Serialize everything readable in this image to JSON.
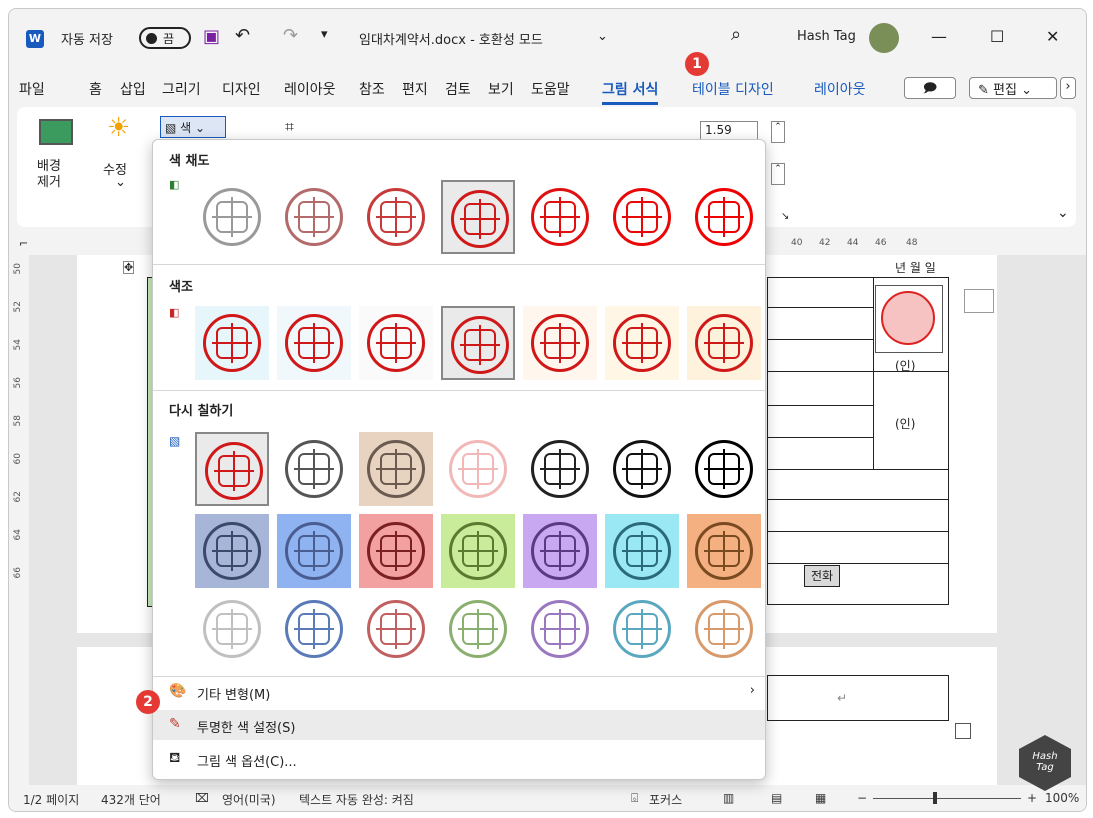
{
  "titlebar": {
    "autosave_label": "자동 저장",
    "autosave_state": "끔",
    "doc_title": "임대차계약서.docx - 호환성 모드",
    "doc_title_chevron": "⌄",
    "user_name": "Hash Tag",
    "undo_icon": "↶",
    "redo_icon": "↷",
    "customize_icon": "▾",
    "search_icon": "⌕",
    "minimize": "—",
    "maximize": "☐",
    "close": "✕"
  },
  "tabs": [
    "파일",
    "홈",
    "삽입",
    "그리기",
    "디자인",
    "레이아웃",
    "참조",
    "편지",
    "검토",
    "보기",
    "도움말",
    "그림 서식",
    "테이블 디자인",
    "레이아웃"
  ],
  "tab_active": "그림 서식",
  "tab_buttons": {
    "comment": "🗩",
    "edit": "편집",
    "edit_chevron": "⌄",
    "more": "›"
  },
  "ribbon": {
    "remove_bg_line1": "배경",
    "remove_bg_line2": "제거",
    "corrections": "수정",
    "corrections_chevron": "⌄",
    "color": "색",
    "color_chevron": "⌄",
    "height_value": "1.59 cm",
    "collapse": "⌄"
  },
  "ruler": {
    "ticks": [
      "40",
      "42",
      "44",
      "46",
      "48"
    ]
  },
  "vruler": {
    "ticks": [
      "50",
      "52",
      "54",
      "56",
      "58",
      "60",
      "62",
      "64",
      "66"
    ]
  },
  "document": {
    "date_text": "년  월  일",
    "seal1": "(인)",
    "seal2": "(인)",
    "phone": "전화",
    "return_mark": "↵"
  },
  "menu": {
    "section_saturation": "색 채도",
    "section_tone": "색조",
    "section_recolor": "다시 칠하기",
    "item_variations": "기타 변형(M)",
    "item_variations_arrow": "›",
    "item_transparent": "투명한 색 설정(S)",
    "item_options": "그림 색 옵션(C)..."
  },
  "callouts": {
    "one": "1",
    "two": "2"
  },
  "status": {
    "page": "1/2 페이지",
    "words": "432개 단어",
    "language": "영어(미국)",
    "autocomplete": "텍스트 자동 완성: 켜짐",
    "focus": "포커스",
    "zoom": "100%"
  },
  "watermark": {
    "line1": "Hash",
    "line2": "Tag"
  },
  "colors": {
    "accent": "#185abd",
    "stamp_red": "#d11111",
    "badge_red": "#e53935"
  }
}
